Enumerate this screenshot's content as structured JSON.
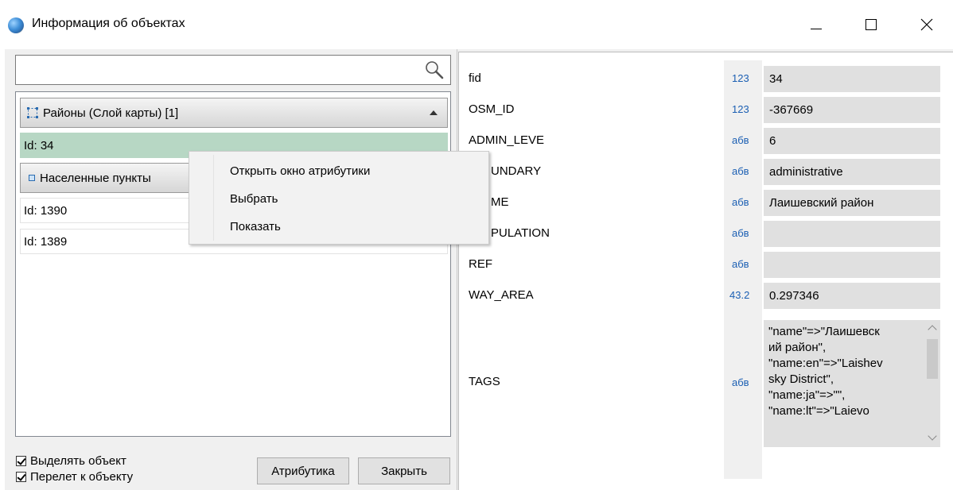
{
  "window": {
    "title": "Информация об объектах",
    "icon": "globe-icon"
  },
  "search": {
    "value": "",
    "placeholder": ""
  },
  "tree": {
    "groups": [
      {
        "label": "Районы (Слой карты) [1]",
        "icon": "layer-icon",
        "expanded": true,
        "items": [
          {
            "label": "Id: 34",
            "selected": true
          }
        ]
      },
      {
        "label": "Населенные пункты",
        "icon": "point-layer-icon",
        "expanded": true,
        "items": [
          {
            "label": "Id: 1390"
          },
          {
            "label": "Id: 1389"
          }
        ]
      }
    ]
  },
  "options": {
    "highlight_object": {
      "label": "Выделять объект",
      "checked": true
    },
    "fly_to_object": {
      "label": "Перелет к объекту",
      "checked": true
    }
  },
  "buttons": {
    "attributes": "Атрибутика",
    "close": "Закрыть"
  },
  "context_menu": {
    "items": [
      "Открыть окно атрибутики",
      "Выбрать",
      "Показать"
    ]
  },
  "attributes": [
    {
      "name": "fid",
      "type": "123",
      "value": "34"
    },
    {
      "name": "OSM_ID",
      "type": "123",
      "value": "-367669"
    },
    {
      "name": "ADMIN_LEVE",
      "type": "абв",
      "value": "6"
    },
    {
      "name": "BOUNDARY",
      "shown_name": "UNDARY",
      "type": "абв",
      "value": "administrative"
    },
    {
      "name": "NAME",
      "shown_name": "ME",
      "type": "абв",
      "value": "Лаишевский район"
    },
    {
      "name": "POPULATION",
      "shown_name": "PULATION",
      "type": "абв",
      "value": ""
    },
    {
      "name": "REF",
      "type": "абв",
      "value": ""
    },
    {
      "name": "WAY_AREA",
      "type": "43.2",
      "value": "0.297346"
    },
    {
      "name": "TAGS",
      "type": "абв",
      "value_lines": [
        "\"name\"=>\"Лаишевск",
        "ий район\",",
        "\"name:en\"=>\"Laishev",
        "sky District\",",
        "\"name:ja\"=>\"\",",
        "\"name:lt\"=>\"Laievo"
      ]
    }
  ],
  "colors": {
    "selected_row": "#b7d7c4",
    "type_badge": "#1b5fb3"
  }
}
